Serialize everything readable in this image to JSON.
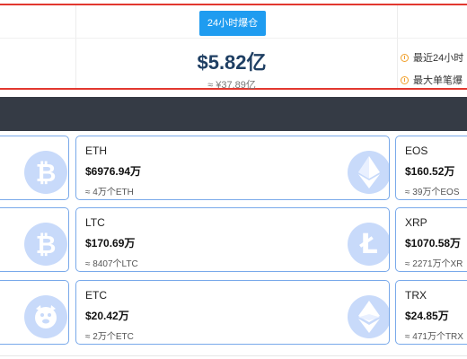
{
  "stats": {
    "tab_label": "24小时爆仓",
    "total_amount": "$5.82亿",
    "total_cny": "≈ ¥37.89亿",
    "side_items": [
      "最近24小时",
      "最大单笔爆"
    ]
  },
  "cards": [
    {
      "symbol": "",
      "amount": "",
      "qty": "",
      "icon": "bitcoin-icon"
    },
    {
      "symbol": "ETH",
      "amount": "$6976.94万",
      "qty": "≈ 4万个ETH",
      "icon": "ethereum-icon"
    },
    {
      "symbol": "EOS",
      "amount": "$160.52万",
      "qty": "≈ 39万个EOS",
      "icon": ""
    },
    {
      "symbol": "",
      "amount": "",
      "qty": "",
      "icon": "bitcoin-icon"
    },
    {
      "symbol": "LTC",
      "amount": "$170.69万",
      "qty": "≈ 8407个LTC",
      "icon": "litecoin-icon"
    },
    {
      "symbol": "XRP",
      "amount": "$1070.58万",
      "qty": "≈ 2271万个XR",
      "icon": ""
    },
    {
      "symbol": "",
      "amount": "",
      "qty": "",
      "icon": "dogecoin-icon"
    },
    {
      "symbol": "ETC",
      "amount": "$20.42万",
      "qty": "≈ 2万个ETC",
      "icon": "ethereum-classic-icon"
    },
    {
      "symbol": "TRX",
      "amount": "$24.85万",
      "qty": "≈ 471万个TRX",
      "icon": ""
    }
  ],
  "colors": {
    "accent": "#1f9cf0",
    "panel_border": "#e2382f",
    "card_border": "#79a9ea",
    "dark_bar": "#353b45",
    "logo_fill": "#c8dafa"
  }
}
